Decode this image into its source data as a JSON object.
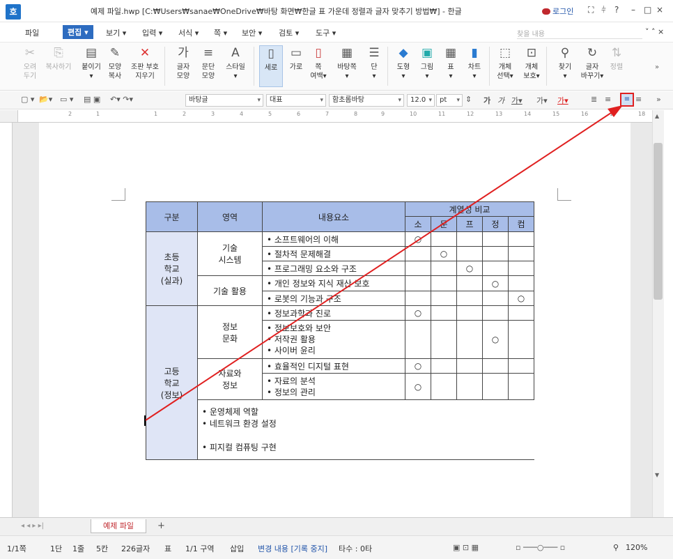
{
  "window": {
    "title": "예제 파일.hwp [C:₩Users₩sanae₩OneDrive₩바탕 화면₩한글 표 가운데 정렬과 글자 맞추기 방법₩] - 한글",
    "login": "로그인",
    "app_icon": "호"
  },
  "menu": [
    "파일",
    "편집 ▾",
    "보기 ▾",
    "입력 ▾",
    "서식 ▾",
    "쪽 ▾",
    "보안 ▾",
    "검토 ▾",
    "도구 ▾"
  ],
  "find_placeholder": "찾을 내용",
  "ribbon": [
    {
      "label": "오려\n두기",
      "icon": "✂",
      "disabled": true
    },
    {
      "label": "복사하기",
      "icon": "⎘",
      "disabled": true
    },
    {
      "label": "붙이기\n▾",
      "icon": "📋",
      "disabled": false
    },
    {
      "label": "모양\n복사",
      "icon": "🖌",
      "disabled": false
    },
    {
      "label": "조판 부호\n지우기",
      "icon": "✖",
      "disabled": false
    },
    {
      "label": "글자\n모양",
      "icon": "가",
      "disabled": false
    },
    {
      "label": "문단\n모양",
      "icon": "≡",
      "disabled": false
    },
    {
      "label": "스타일\n▾",
      "icon": "A",
      "disabled": false
    },
    {
      "label": "세로",
      "icon": "▯",
      "disabled": false,
      "active": true
    },
    {
      "label": "가로",
      "icon": "▭",
      "disabled": false
    },
    {
      "label": "쪽\n여백▾",
      "icon": "□",
      "disabled": false
    },
    {
      "label": "바탕쪽\n▾",
      "icon": "▦",
      "disabled": false
    },
    {
      "label": "단\n▾",
      "icon": "☰",
      "disabled": false
    },
    {
      "label": "도형\n▾",
      "icon": "◆",
      "disabled": false
    },
    {
      "label": "그림\n▾",
      "icon": "🖼",
      "disabled": false
    },
    {
      "label": "표\n▾",
      "icon": "▦",
      "disabled": false
    },
    {
      "label": "차트\n▾",
      "icon": "▮",
      "disabled": false
    },
    {
      "label": "개체\n선택▾",
      "icon": "⬚",
      "disabled": false
    },
    {
      "label": "개체\n보호▾",
      "icon": "🔒",
      "disabled": false
    },
    {
      "label": "찾기\n▾",
      "icon": "🔭",
      "disabled": false
    },
    {
      "label": "글자\n바꾸기▾",
      "icon": "↻",
      "disabled": false
    },
    {
      "label": "정렬",
      "icon": "⇅",
      "disabled": true
    }
  ],
  "format": {
    "style": "바탕글",
    "style2": "대표",
    "font": "함초롬바탕",
    "size": "12.0",
    "unit": "pt"
  },
  "ruler_numbers": [
    "2",
    "1",
    "1",
    "2",
    "3",
    "4",
    "5",
    "6",
    "7",
    "8",
    "9",
    "10",
    "11",
    "12",
    "13",
    "14",
    "15",
    "16",
    "17",
    "18"
  ],
  "table": {
    "h_category": "구분",
    "h_area": "영역",
    "h_content": "내용요소",
    "h_compare": "계열성 비교",
    "sub": [
      "소",
      "문",
      "프",
      "정",
      "컴"
    ],
    "circle": "○",
    "elem": "초등\n학교\n(실과)",
    "elem_a1": "기술\n시스템",
    "elem_a2": "기술 활용",
    "r1": "• 소프트웨어의 이해",
    "r2": "• 절차적 문제해결",
    "r3": "• 프로그래밍 요소와 구조",
    "r4": "• 개인 정보와 지식 재산 보호",
    "r5": "• 로봇의 기능과 구조",
    "high": "고등\n학교\n(정보)",
    "high_a1": "정보\n문화",
    "high_a2": "자료와\n정보",
    "r6": "• 정보과학과 진로",
    "r7": "• 정보보호와 보안\n• 저작권 활용\n• 사이버 윤리",
    "r8": "• 효율적인 디지털 표현",
    "r9": "• 자료의 분석\n• 정보의 관리",
    "r10": "• 운영체제 역할\n• 네트워크 환경 설정\n\n• 피지컬 컴퓨팅 구현"
  },
  "sheet_tab": "예제 파일",
  "status": [
    "1/1쪽",
    "1단",
    "1줄",
    "5칸",
    "226글자",
    "표",
    "1/1 구역",
    "삽입",
    "변경 내용 [기록 중지]",
    "타수 : 0타"
  ],
  "zoom": "120%",
  "arrow_color": "#e02020"
}
